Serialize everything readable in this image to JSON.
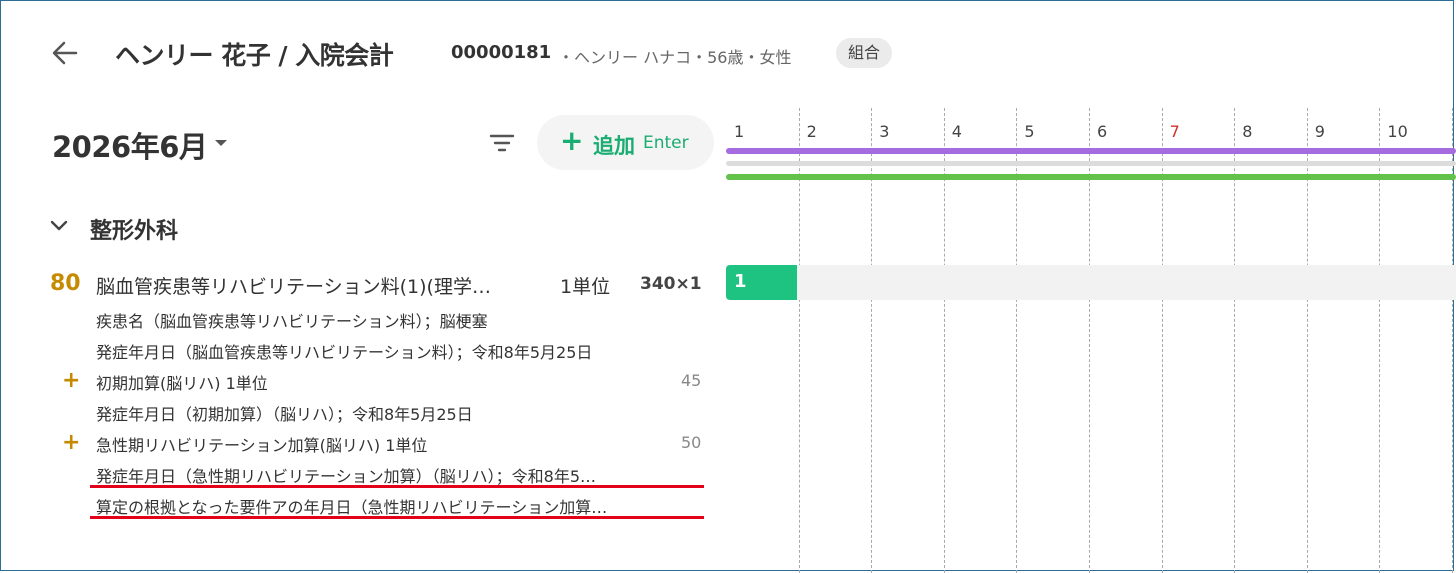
{
  "header": {
    "title": "ヘンリー 花子 / 入院会計",
    "patient_id": "00000181",
    "patient_meta": "・ヘンリー ハナコ・56歳・女性",
    "insurance_badge": "組合"
  },
  "toolbar": {
    "month": "2026年6月",
    "add_label": "追加",
    "add_hint": "Enter"
  },
  "section": {
    "title": "整形外科"
  },
  "item": {
    "points": "80",
    "name": "脳血管疾患等リハビリテーション料(1)(理学…",
    "unit": "1単位",
    "qty": "340×1",
    "details": [
      "疾患名（脳血管疾患等リハビリテーション料）；脳梗塞",
      "発症年月日（脳血管疾患等リハビリテーション料）；令和8年5月25日"
    ],
    "addons": [
      {
        "name": "初期加算(脳リハ) 1単位",
        "points": "45",
        "details": [
          "発症年月日（初期加算）（脳リハ）；令和8年5月25日"
        ]
      },
      {
        "name": "急性期リハビリテーション加算(脳リハ) 1単位",
        "points": "50",
        "details": [
          "発症年月日（急性期リハビリテーション加算）（脳リハ）；令和8年5…",
          "算定の根拠となった要件アの年月日（急性期リハビリテーション加算…"
        ]
      }
    ]
  },
  "calendar": {
    "days": [
      "1",
      "2",
      "3",
      "4",
      "5",
      "6",
      "7",
      "8",
      "9",
      "10"
    ],
    "highlight_day": "7",
    "cell_value": "1",
    "colors": {
      "holiday": "#d0312d",
      "purple": "#a56ce0",
      "gray": "#dcdcdc",
      "green": "#63c24a",
      "cell": "#1ec382",
      "annotation": "#e3001b"
    }
  }
}
